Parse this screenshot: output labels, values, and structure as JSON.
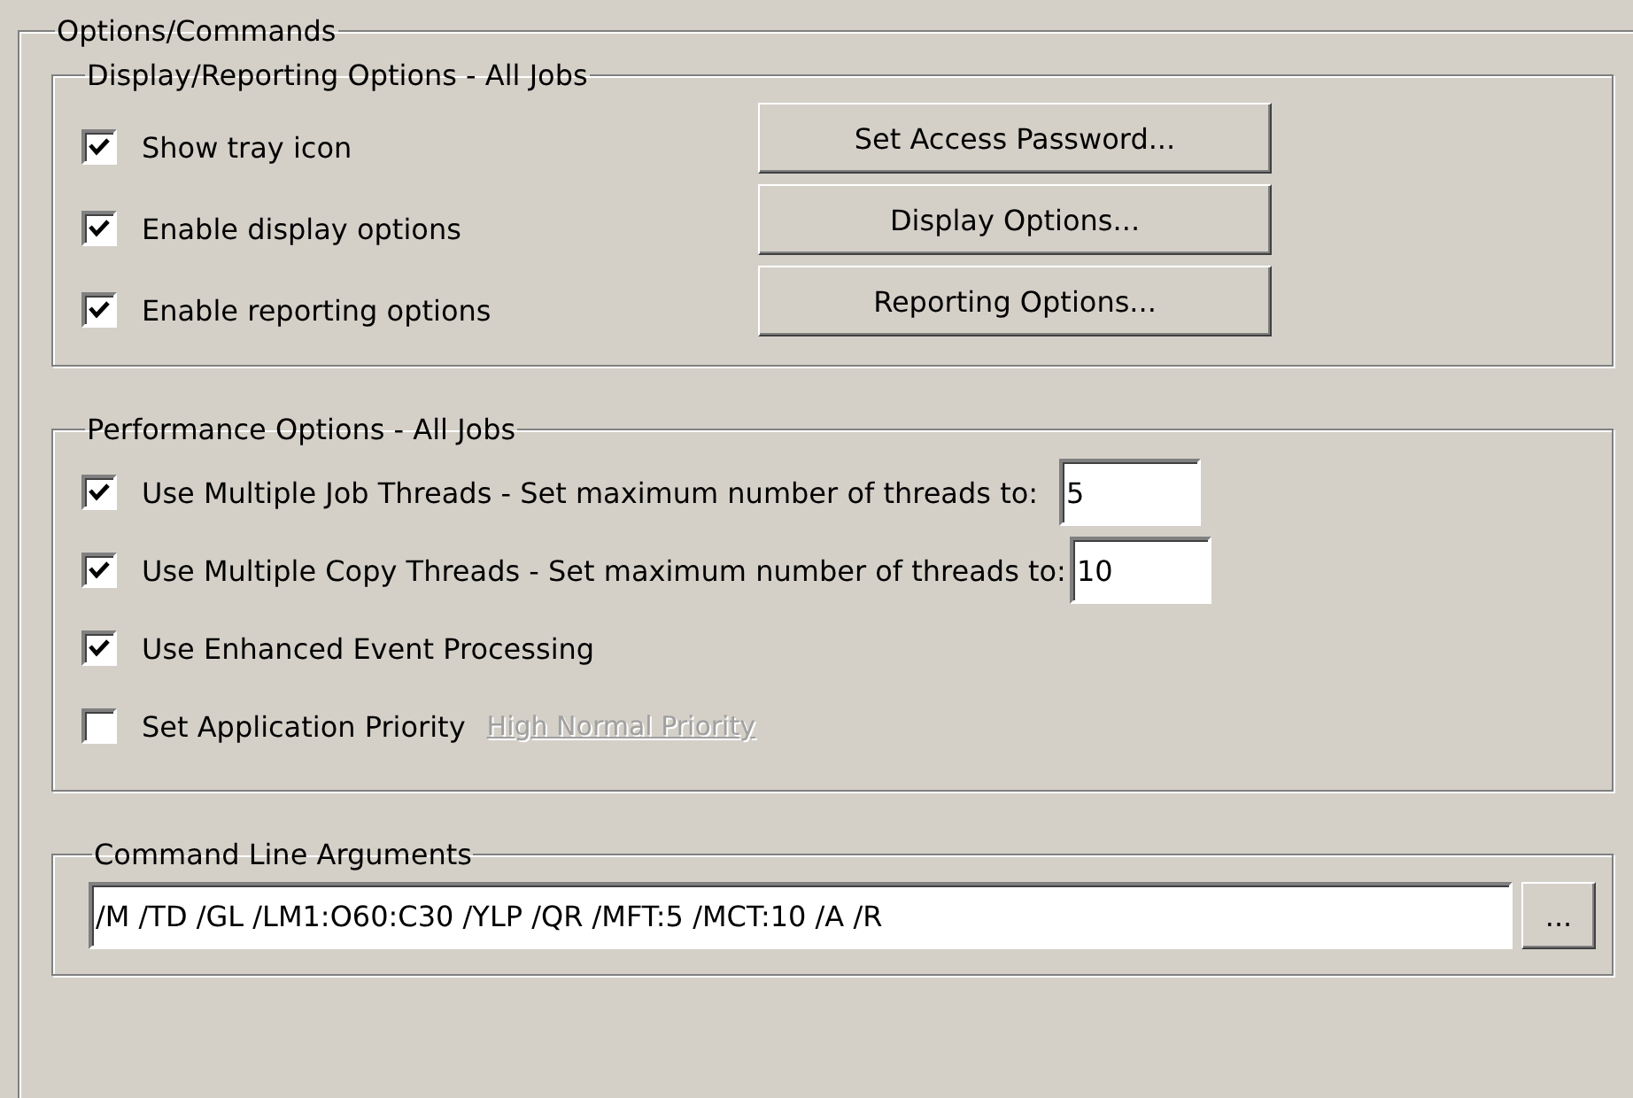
{
  "group_title": "Options/Commands",
  "display": {
    "title": "Display/Reporting Options - All Jobs",
    "checkboxes": [
      {
        "label": "Show tray icon",
        "checked": true
      },
      {
        "label": "Enable display options",
        "checked": true
      },
      {
        "label": "Enable reporting options",
        "checked": true
      }
    ],
    "buttons": [
      "Set Access Password...",
      "Display Options...",
      "Reporting Options..."
    ]
  },
  "performance": {
    "title": "Performance Options - All Jobs",
    "rows": [
      {
        "kind": "number",
        "label": "Use Multiple Job Threads - Set maximum number of threads to:",
        "checked": true,
        "value": "5"
      },
      {
        "kind": "number",
        "label": "Use Multiple Copy Threads - Set maximum number of threads to:",
        "checked": true,
        "value": "10"
      },
      {
        "kind": "plain",
        "label": "Use Enhanced Event Processing",
        "checked": true
      },
      {
        "kind": "link",
        "label": "Set Application Priority",
        "checked": false,
        "link": {
          "label": "High Normal Priority",
          "disabled": true
        }
      }
    ]
  },
  "command": {
    "title": "Command Line Arguments",
    "value": "/M /TD /GL /LM1:O60:C30 /YLP /QR /MFT:5 /MCT:10 /A /R",
    "browse_button": "..."
  }
}
